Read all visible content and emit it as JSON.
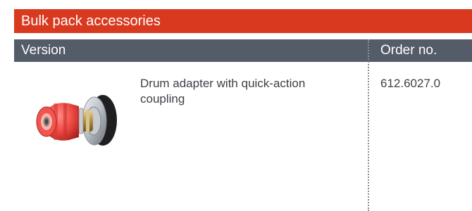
{
  "section": {
    "title": "Bulk pack accessories"
  },
  "table": {
    "headers": {
      "version": "Version",
      "order_no": "Order no."
    },
    "rows": [
      {
        "image_icon": "drum-adapter-image",
        "description": "Drum adapter with quick-action coupling",
        "order_no": "612.6027.0"
      }
    ]
  },
  "colors": {
    "title_bar": "#d9391f",
    "header_bar": "#535c68",
    "text": "#3c4046",
    "divider": "#8a8f96"
  }
}
